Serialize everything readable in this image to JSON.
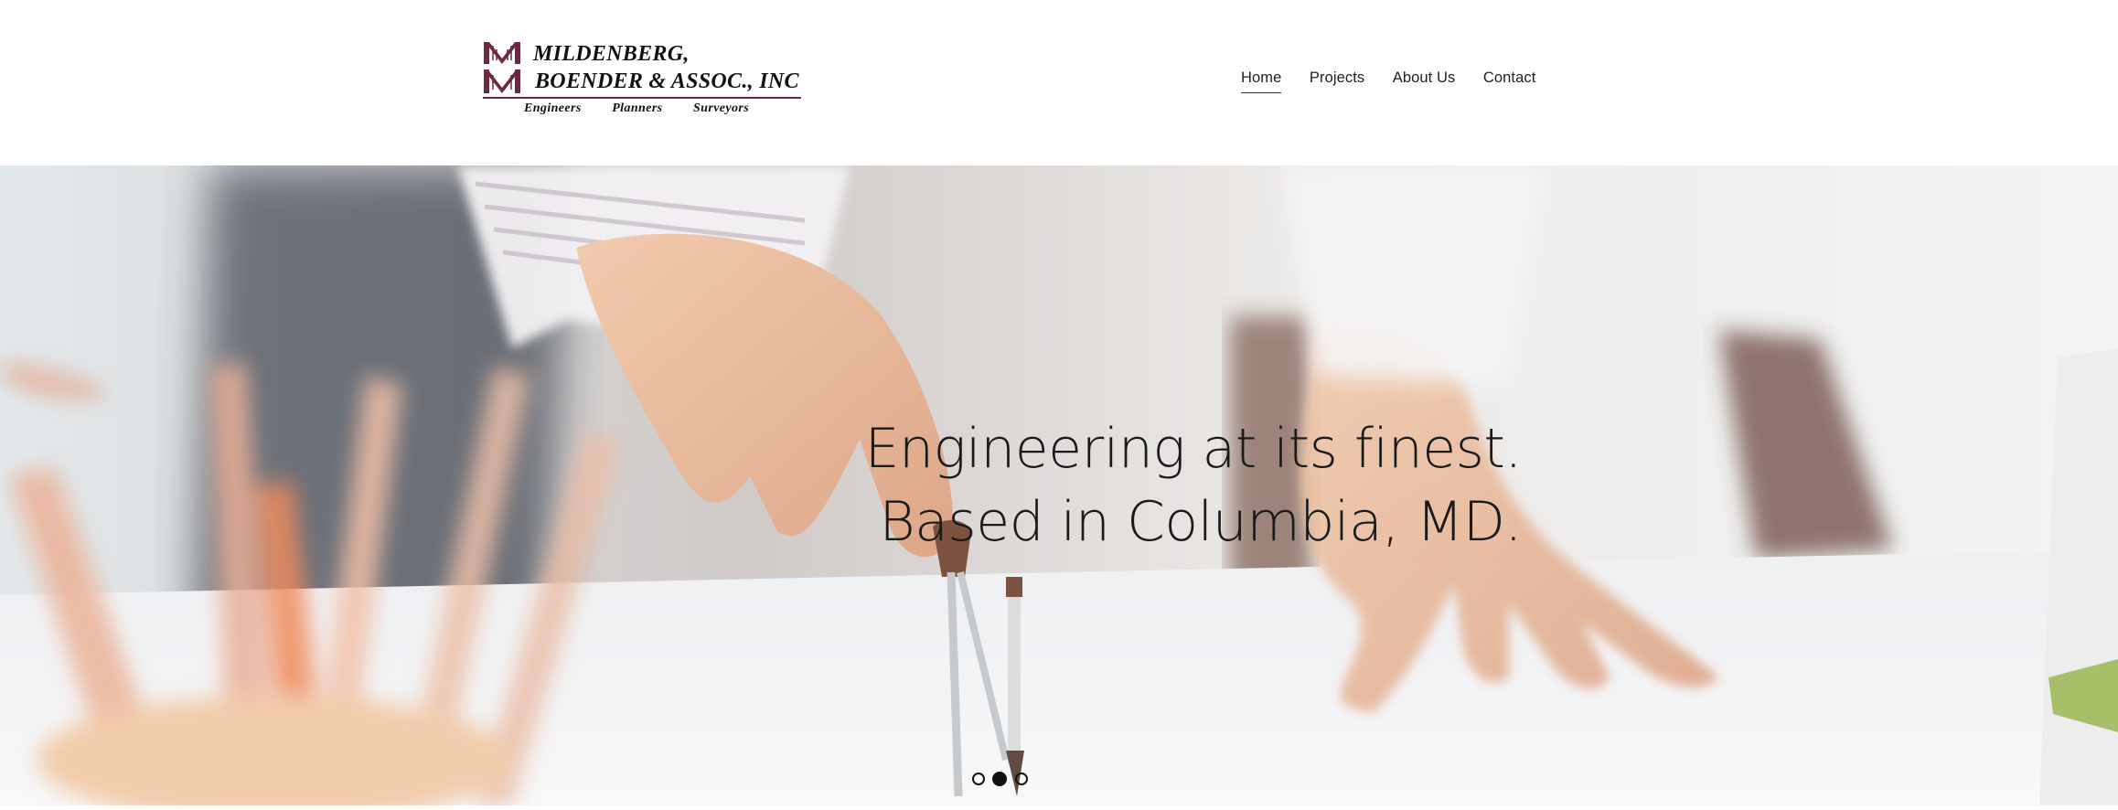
{
  "header": {
    "logo": {
      "line1": "MILDENBERG,",
      "line2": "BOENDER & ASSOC., INC",
      "tags": [
        "Engineers",
        "Planners",
        "Surveyors"
      ],
      "icon": "mb-monogram-icon",
      "brand_color": "#6b2b3c"
    },
    "nav": {
      "items": [
        {
          "label": "Home",
          "active": true
        },
        {
          "label": "Projects",
          "active": false
        },
        {
          "label": "About Us",
          "active": false
        },
        {
          "label": "Contact",
          "active": false
        }
      ]
    }
  },
  "hero": {
    "headline_line1": "Engineering at its finest.",
    "headline_line2": "Based in Columbia, MD.",
    "slider": {
      "slide_count": 3,
      "active_index": 1
    }
  }
}
